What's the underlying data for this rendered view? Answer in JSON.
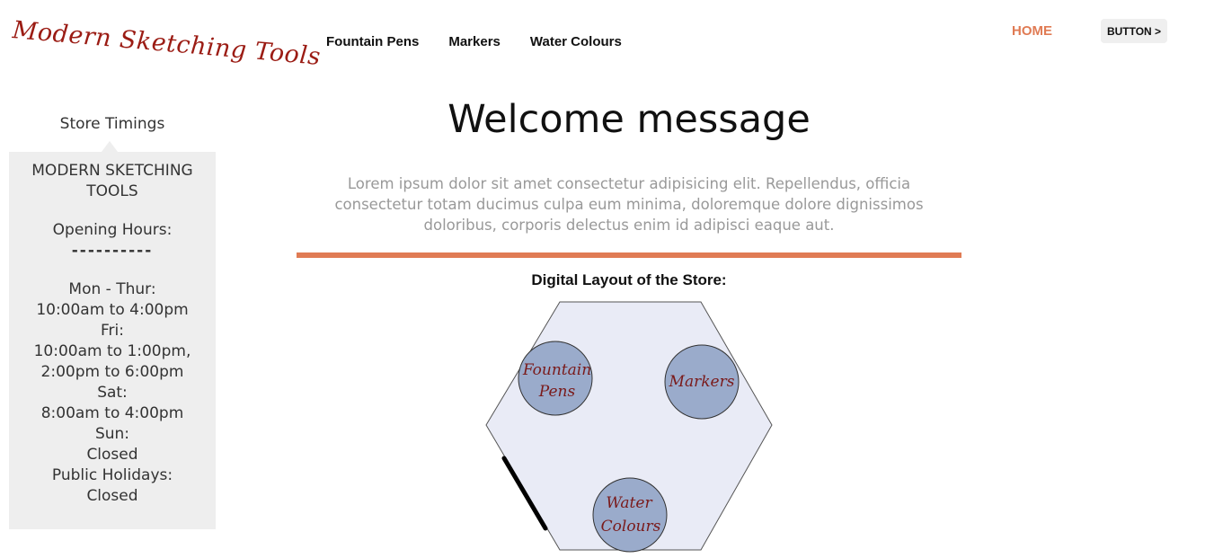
{
  "header": {
    "logo_text": "Modern Sketching Tools",
    "nav": [
      "Fountain Pens",
      "Markers",
      "Water Colours"
    ],
    "home_label": "HOME",
    "button_label": "BUTTON >"
  },
  "sidebar": {
    "title": "Store Timings",
    "store_name_line1": "MODERN SKETCHING",
    "store_name_line2": "TOOLS",
    "opening_label": "Opening Hours:",
    "dashes": "----------",
    "hours": [
      "Mon - Thur:",
      "10:00am to 4:00pm",
      "Fri:",
      "10:00am to 1:00pm,",
      "2:00pm to 6:00pm",
      "Sat:",
      "8:00am to 4:00pm",
      "Sun:",
      "Closed",
      "Public Holidays:",
      "Closed"
    ]
  },
  "main": {
    "welcome": "Welcome message",
    "lorem": "Lorem ipsum dolor sit amet consectetur adipisicing elit. Repellendus, officia consectetur totam ducimus culpa eum minima, doloremque dolore dignissimos doloribus, corporis delectus enim id adipisci eaque aut.",
    "layout_title": "Digital Layout of the Store:",
    "zones": {
      "fountain_line1": "Fountain",
      "fountain_line2": "Pens",
      "markers": "Markers",
      "water_line1": "Water",
      "water_line2": "Colours"
    }
  },
  "colors": {
    "accent": "#e07b54",
    "logo": "#9b1c14",
    "zone_fill": "#9aabcb",
    "floor_fill": "#e9ebf6"
  }
}
